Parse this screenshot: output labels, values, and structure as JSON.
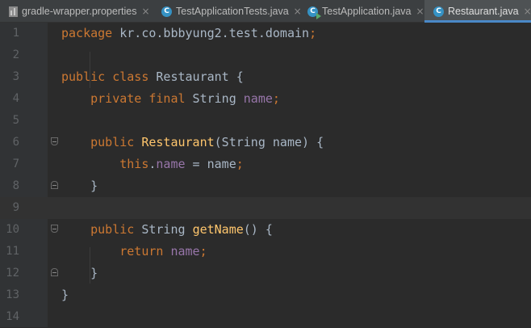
{
  "tabs": [
    {
      "label": "gradle-wrapper.properties",
      "icon": "properties-file-icon",
      "close": "×",
      "active": false
    },
    {
      "label": "TestApplicationTests.java",
      "icon": "java-class-icon",
      "icon_glyph": "C",
      "close": "×",
      "active": false
    },
    {
      "label": "TestApplication.java",
      "icon": "java-runnable-class-icon",
      "icon_glyph": "C",
      "close": "×",
      "active": false
    },
    {
      "label": "Restaurant.java",
      "icon": "java-class-icon",
      "icon_glyph": "C",
      "close": "×",
      "active": true
    }
  ],
  "editor": {
    "current_line": 9,
    "lines": [
      {
        "n": "1",
        "tokens": [
          [
            "kw",
            "package"
          ],
          [
            "p",
            " kr.co.bbbyung2.test.domain"
          ],
          [
            "kw",
            ";"
          ]
        ]
      },
      {
        "n": "2",
        "tokens": []
      },
      {
        "n": "3",
        "tokens": [
          [
            "kw",
            "public class"
          ],
          [
            "p",
            " Restaurant {"
          ]
        ]
      },
      {
        "n": "4",
        "tokens": [
          [
            "p",
            "    "
          ],
          [
            "kw",
            "private final"
          ],
          [
            "p",
            " String "
          ],
          [
            "fld",
            "name"
          ],
          [
            "kw",
            ";"
          ]
        ]
      },
      {
        "n": "5",
        "tokens": []
      },
      {
        "n": "6",
        "tokens": [
          [
            "p",
            "    "
          ],
          [
            "kw",
            "public"
          ],
          [
            "p",
            " "
          ],
          [
            "fn",
            "Restaurant"
          ],
          [
            "p",
            "(String name) {"
          ]
        ]
      },
      {
        "n": "7",
        "tokens": [
          [
            "p",
            "        "
          ],
          [
            "kw",
            "this"
          ],
          [
            "p",
            "."
          ],
          [
            "fld",
            "name"
          ],
          [
            "p",
            " = name"
          ],
          [
            "kw",
            ";"
          ]
        ]
      },
      {
        "n": "8",
        "tokens": [
          [
            "p",
            "    }"
          ]
        ]
      },
      {
        "n": "9",
        "tokens": []
      },
      {
        "n": "10",
        "tokens": [
          [
            "p",
            "    "
          ],
          [
            "kw",
            "public"
          ],
          [
            "p",
            " String "
          ],
          [
            "fn",
            "getName"
          ],
          [
            "p",
            "() {"
          ]
        ]
      },
      {
        "n": "11",
        "tokens": [
          [
            "p",
            "        "
          ],
          [
            "kw",
            "return"
          ],
          [
            "p",
            " "
          ],
          [
            "fld",
            "name"
          ],
          [
            "kw",
            ";"
          ]
        ]
      },
      {
        "n": "12",
        "tokens": [
          [
            "p",
            "    }"
          ]
        ]
      },
      {
        "n": "13",
        "tokens": [
          [
            "p",
            "}"
          ]
        ]
      },
      {
        "n": "14",
        "tokens": []
      }
    ]
  },
  "colors": {
    "keyword": "#cc7832",
    "field": "#9876aa",
    "method": "#ffc66d",
    "plain": "#a9b7c6",
    "background": "#2b2b2b",
    "gutter": "#313335",
    "line_number": "#606366",
    "active_tab_underline": "#4a88c7"
  }
}
